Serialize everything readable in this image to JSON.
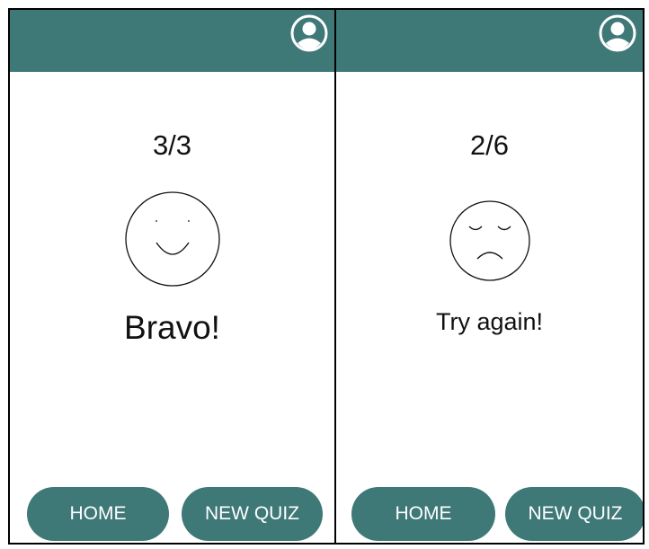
{
  "colors": {
    "accent": "#3e7877",
    "button_text": "#ffffff",
    "text": "#111111"
  },
  "screens": [
    {
      "score": "3/3",
      "face_icon": "smiling-face-icon",
      "message": "Bravo!",
      "buttons": {
        "home": "HOME",
        "new_quiz": "NEW QUIZ"
      }
    },
    {
      "score": "2/6",
      "face_icon": "sad-face-icon",
      "message": "Try again!",
      "buttons": {
        "home": "HOME",
        "new_quiz": "NEW QUIZ"
      }
    }
  ]
}
